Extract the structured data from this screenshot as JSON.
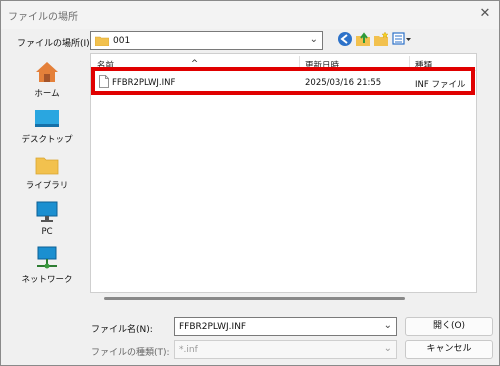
{
  "window": {
    "title": "ファイルの場所"
  },
  "lookin": {
    "label": "ファイルの場所(I):",
    "value": "001"
  },
  "places": [
    {
      "label": "ホーム",
      "icon": "home-icon"
    },
    {
      "label": "デスクトップ",
      "icon": "desktop-icon"
    },
    {
      "label": "ライブラリ",
      "icon": "library-icon"
    },
    {
      "label": "PC",
      "icon": "pc-icon"
    },
    {
      "label": "ネットワーク",
      "icon": "network-icon"
    }
  ],
  "filelist": {
    "columns": [
      "名前",
      "更新日時",
      "種類"
    ],
    "rows": [
      {
        "name": "FFBR2PLWJ.INF",
        "modified": "2025/03/16 21:55",
        "type": "INF ファイル"
      }
    ]
  },
  "filename": {
    "label": "ファイル名(N):",
    "value": "FFBR2PLWJ.INF"
  },
  "filetype": {
    "label": "ファイルの種類(T):",
    "value": "*.inf"
  },
  "buttons": {
    "open": "開く(O)",
    "cancel": "キャンセル"
  },
  "colors": {
    "highlight": "#e00000",
    "folder": "#f2c14e",
    "accent": "#0a64c8"
  }
}
